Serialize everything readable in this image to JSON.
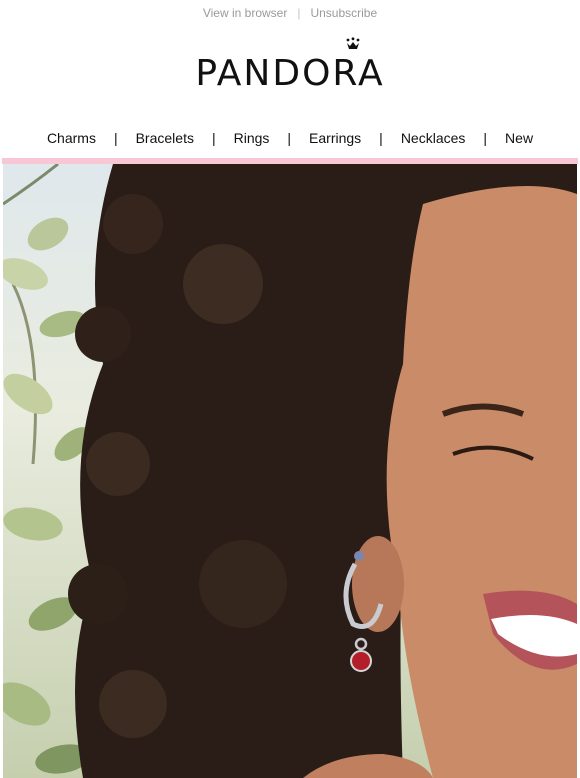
{
  "preheader": {
    "view_in_browser": "View in browser",
    "separator": "|",
    "unsubscribe": "Unsubscribe"
  },
  "brand": {
    "logo_text": "PANDORA",
    "accent_color": "#f7c8d3"
  },
  "nav": {
    "items": [
      "Charms",
      "Bracelets",
      "Rings",
      "Earrings",
      "Necklaces",
      "New"
    ],
    "separator": "|"
  },
  "hero": {
    "image_subject": "smiling-woman-with-curly-hair-wearing-charm-hoop-earring"
  }
}
